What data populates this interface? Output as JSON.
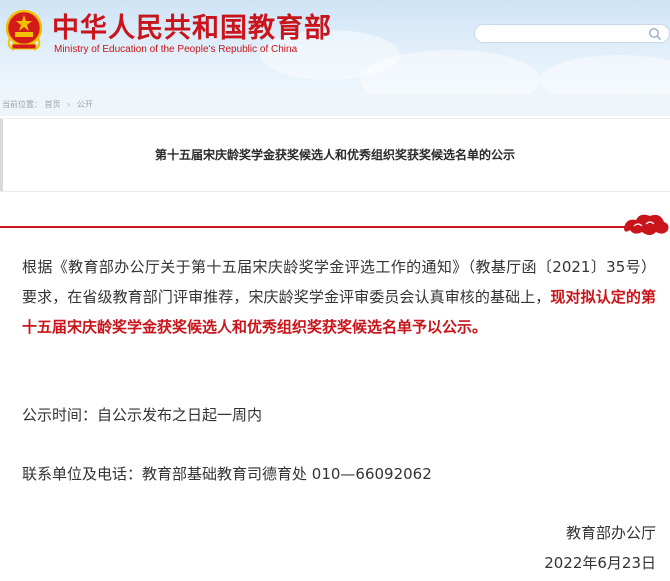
{
  "header": {
    "title": "中华人民共和国教育部",
    "subtitle": "Ministry of Education of the People's Republic of China",
    "search": {
      "placeholder": ""
    }
  },
  "breadcrumb": {
    "label": "当前位置：",
    "items": [
      "首页",
      "公开"
    ],
    "separator": "›"
  },
  "article": {
    "title": "第十五届宋庆龄奖学金获奖候选人和优秀组织奖获奖候选名单的公示",
    "para1_plain": "根据《教育部办公厅关于第十五届宋庆龄奖学金评选工作的通知》（教基厅函〔2021〕35号）要求，在省级教育部门评审推荐，宋庆龄奖学金评审委员会认真审核的基础上，",
    "para1_highlight": "现对拟认定的第十五届宋庆龄奖学金获奖候选人和优秀组织奖获奖候选名单予以公示。",
    "para2": "公示时间：自公示发布之日起一周内",
    "para3": "联系单位及电话：教育部基础教育司德育处  010—66092062",
    "signature_org": "教育部办公厅",
    "signature_date": "2022年6月23日"
  },
  "colors": {
    "brand_red": "#c8141a",
    "header_blue": "#cfe4f6",
    "body_text": "#333333"
  },
  "icons": [
    "national-emblem-icon",
    "search-icon",
    "cloud-ornament-icon"
  ]
}
